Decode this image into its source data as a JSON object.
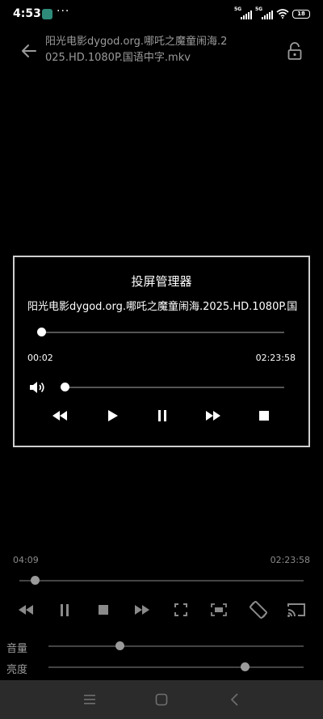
{
  "status_bar": {
    "time": "4:53",
    "dots": "···",
    "network_1": "5G",
    "network_2": "5G",
    "battery": "18"
  },
  "header": {
    "file_title": "阳光电影dygod.org.哪吒之魔童闹海.2025.HD.1080P.国语中字.mkv"
  },
  "cast_dialog": {
    "title": "投屏管理器",
    "file_name": "阳光电影dygod.org.哪吒之魔童闹海.2025.HD.1080P.国语中字.mkv",
    "progress_fraction": 0.001,
    "time_current": "00:02",
    "time_total": "02:23:58",
    "volume_fraction": 0.0
  },
  "player": {
    "time_current": "04:09",
    "time_total": "02:23:58",
    "progress_fraction": 0.029,
    "volume_label": "音量",
    "volume_fraction": 0.28,
    "brightness_label": "亮度",
    "brightness_fraction": 0.77
  },
  "colors": {
    "background": "#000000",
    "text_dim": "#9b9b9b",
    "dialog_border": "#cfcfcf",
    "nav_bar": "#2b2b2b"
  },
  "icons": {
    "back": "arrow-left-icon",
    "lock": "lock-open-icon",
    "volume": "speaker-icon",
    "rewind": "rewind-icon",
    "play": "play-icon",
    "pause": "pause-icon",
    "fast_forward": "fast-forward-icon",
    "stop": "stop-icon",
    "fullscreen": "fullscreen-icon",
    "fit_screen": "fit-screen-icon",
    "rotate": "screen-rotate-icon",
    "cast": "cast-icon"
  }
}
